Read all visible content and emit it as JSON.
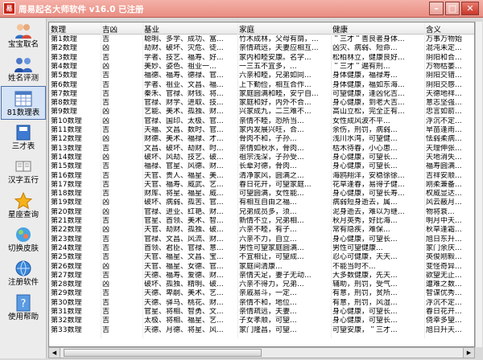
{
  "window": {
    "app_icon": "易",
    "title": "周易起名大师软件 v16.0 已注册",
    "minimize": "–",
    "maximize": "□",
    "close": "✕"
  },
  "sidebar": [
    {
      "label": "宝宝取名",
      "icon": "baby-icon"
    },
    {
      "label": "姓名评测",
      "icon": "people-icon"
    },
    {
      "label": "81数理表",
      "icon": "table-icon"
    },
    {
      "label": "三才表",
      "icon": "book-icon"
    },
    {
      "label": "汉字五行",
      "icon": "books-icon"
    },
    {
      "label": "星座查询",
      "icon": "star-icon"
    },
    {
      "label": "切换皮肤",
      "icon": "skin-icon"
    },
    {
      "label": "注册软件",
      "icon": "globe-icon"
    },
    {
      "label": "使用帮助",
      "icon": "help-icon"
    }
  ],
  "table": {
    "headers": [
      "数理",
      "吉凶",
      "基业",
      "家庭",
      "健康",
      "含义"
    ],
    "rows": [
      [
        "第1数理",
        "吉",
        "聪明、多学、成功、富...",
        "竹木成林，父母有荫，...",
        "＂三才＂善良者身体...",
        "万事万物始"
      ],
      [
        "第2数理",
        "凶",
        "劫财、破坏、灾危、徒...",
        "亲情疏远，夫妻应相互...",
        "凶灾、病弱、短命...",
        "混沌未定..."
      ],
      [
        "第3数理",
        "吉",
        "学者、技艺、福寿、好...",
        "家内和睦安康。名字...",
        "松柏林立，健康良好...",
        "阴阳和合..."
      ],
      [
        "第4数理",
        "凶",
        "美妙、姿色、祖业一...",
        "一三五不宜多，...",
        "＂三才＂遍有刑...",
        "万物枯萎..."
      ],
      [
        "第5数理",
        "吉",
        "福德、福寿、德禄、官...",
        "六亲和睦，兄弟如同...",
        "身体健康，福禄寿...",
        "阴阳交错..."
      ],
      [
        "第6数理",
        "吉",
        "学者、祖业、文昌、福...",
        "上下勤俭，相互合作...",
        "身体健康，福如东海...",
        "阴阳交感..."
      ],
      [
        "第7数理",
        "吉",
        "秦禾、官禄、财钱、将...",
        "家庭圆满和睦，安宁自...",
        "可望健康，逢凶化吉...",
        "天德地祥..."
      ],
      [
        "第8数理",
        "吉",
        "官禄、财学、进取、技...",
        "家庭和好，内外不合...",
        "身心健康，到老大吉...",
        "意志坚强..."
      ],
      [
        "第9数理",
        "凶",
        "艺能、美术、孤独、财...",
        "兴家成九，二三难不...",
        "高山立松，完全正有...",
        "忠言如箭..."
      ],
      [
        "第10数理",
        "凶",
        "官禄、国印、太极、官...",
        "亲情不睦，恐所当...",
        "女性成风波不平...",
        "浮沉不定..."
      ],
      [
        "第11数理",
        "吉",
        "天福、文昌、数时、官...",
        "家内发展兴旺，合...",
        "余伤，刑罚，病弱...",
        "旱苗逢雨..."
      ],
      [
        "第12数理",
        "凶",
        "财德、美术、福禄、才...",
        "骨肉不和，子孙...",
        "浅川水湾，可望健...",
        "怯弱柔病..."
      ],
      [
        "第13数理",
        "吉",
        "文昌、破坏、劫财、时...",
        "亲情如秋水，骨肉...",
        "枯木待春，小心患...",
        "天理伸张..."
      ],
      [
        "第14数理",
        "凶",
        "破坏、风劫、技艺、破...",
        "祖宗浅深，子孙受...",
        "身心健康，可望长...",
        "天地消失..."
      ],
      [
        "第15数理",
        "吉",
        "福禄、官星、风德、财...",
        "长辈对德，骨肉...",
        "身心健康，可望长...",
        "福寿圆满..."
      ],
      [
        "第16数理",
        "吉",
        "天官、贵人、福星、美...",
        "清净家风，圆满之...",
        "海鸥翔洋，安稳徐徐...",
        "吉祥安顺..."
      ],
      [
        "第17数理",
        "吉",
        "天官、福寿、威武、艺...",
        "春日花开，可望家庭...",
        "花草逢春，易得子健...",
        "刚柔兼备..."
      ],
      [
        "第18数理",
        "吉",
        "财库、将星、福星、威...",
        "可望圆满，女性能...",
        "身心健康，可望长寿...",
        "权威显达..."
      ],
      [
        "第19数理",
        "凶",
        "破坏、病弱、孤苦、官...",
        "有相互自由之福...",
        "病弱短身逝去，属...",
        "风云蔽月..."
      ],
      [
        "第20数理",
        "凶",
        "官禄、进业、红艳、财...",
        "兄弟成员多，须...",
        "泥身逝去，难以为继...",
        "物将衰..."
      ],
      [
        "第21数理",
        "吉",
        "官星、首领、美术、智...",
        "新情不立，兄弟相...",
        "秋月英秀，好比海...",
        "明月中天..."
      ],
      [
        "第22数理",
        "凶",
        "天官、劫财、孤独、破...",
        "六亲不睦，有子...",
        "常有隐疾，难保...",
        "秋草逢霜..."
      ],
      [
        "第23数理",
        "吉",
        "官禄、文昌、风流、财...",
        "六亲不力，自立...",
        "身心健康，可望长...",
        "旭日东升..."
      ],
      [
        "第24数理",
        "吉",
        "首领、君臣、官禄、意...",
        "男性可望家庭圆满...",
        "男性可望健康...",
        "家门余庆..."
      ],
      [
        "第25数理",
        "吉",
        "天官、福星、文昌、宝...",
        "不宜相让，可望成...",
        "忍心可健康，天天...",
        "英俊刚毅..."
      ],
      [
        "第26数理",
        "凶",
        "天官、福星、女德、官...",
        "家庭间清康...",
        "不能当时不...",
        "变怪奇异..."
      ],
      [
        "第27数理",
        "吉",
        "天德、福寿、爱德、财...",
        "亲情天足，妻子无动...",
        "大多数健康，先天...",
        "欲望无止..."
      ],
      [
        "第28数理",
        "凶",
        "破坏、孤独、精明、破...",
        "六亲不得力，兄弟...",
        "辅助，刑罚，受气...",
        "遭难之数..."
      ],
      [
        "第29数理",
        "吉",
        "天德、卑嗣、美术、艺...",
        "亲戚易斗，一定...",
        "有意，刑罚，贫所...",
        "智谋优秀..."
      ],
      [
        "第30数理",
        "吉",
        "天德、驿马、桃花、财...",
        "亲情不和，地位...",
        "有意，刑罚，风湿...",
        "浮沉不定..."
      ],
      [
        "第31数理",
        "吉",
        "官星、将相、智勇、文...",
        "亲情疏远，夫妻...",
        "身心健康，可望长...",
        "春日花开..."
      ],
      [
        "第32数理",
        "吉",
        "太极、将相、福星、艺...",
        "子女孝顺，可望...",
        "身心健康，可望长...",
        "侥幸多望..."
      ],
      [
        "第33数理",
        "吉",
        "天德、月德、将星、风...",
        "家门隆昌，可望...",
        "可望安康，＂三才...",
        "旭日升天..."
      ]
    ]
  }
}
